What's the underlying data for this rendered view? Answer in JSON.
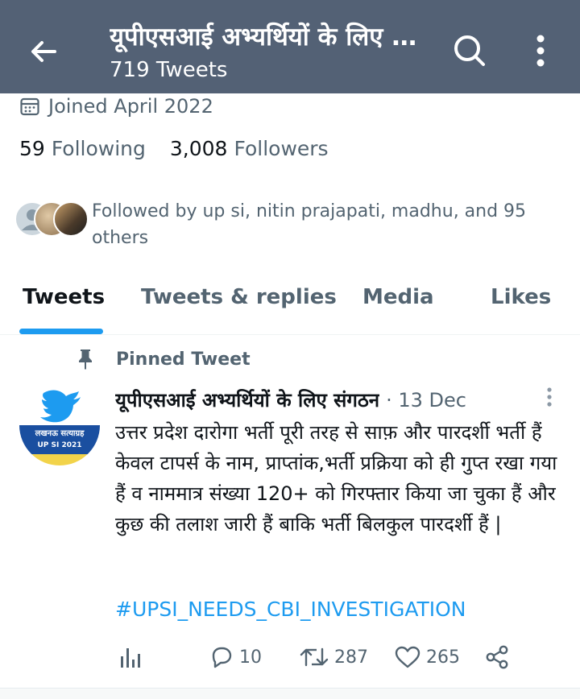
{
  "header": {
    "title": "यूपीएसआई अभ्यर्थियों के लिए संगठन",
    "tweet_count": "719 Tweets"
  },
  "profile": {
    "joined": "Joined April 2022",
    "following_count": "59",
    "following_label": "Following",
    "followers_count": "3,008",
    "followers_label": "Followers",
    "followed_by": "Followed by up si, nitin prajapati, madhu, and 95 others"
  },
  "tabs": [
    {
      "label": "Tweets",
      "active": true
    },
    {
      "label": "Tweets & replies",
      "active": false
    },
    {
      "label": "Media",
      "active": false
    },
    {
      "label": "Likes",
      "active": false
    }
  ],
  "pinned_tweet": {
    "pinned_label": "Pinned Tweet",
    "author_name": "यूपीएसआई अभ्यर्थियों के लिए संगठन",
    "date": "· 13 Dec",
    "avatar_text_1": "लखनऊ सत्याग्रह",
    "avatar_text_2": "UP SI 2021",
    "text": "उत्तर प्रदेश दारोगा भर्ती पूरी तरह से साफ़ और पारदर्शी भर्ती हैं केवल टापर्स के नाम, प्राप्तांक,भर्ती प्रक्रिया को ही गुप्त रखा गया हैं व नाममात्र संख्या 120+ को गिरफ्तार किया जा चुका हैं और कुछ की तलाश जारी हैं बाकि भर्ती बिलकुल पारदर्शी हैं |",
    "hashtag": "#UPSI_NEEDS_CBI_INVESTIGATION",
    "replies": "10",
    "retweets": "287",
    "likes": "265"
  },
  "icons": {
    "back": "arrow-left-icon",
    "search": "search-icon",
    "more": "more-vertical-icon",
    "calendar": "calendar-icon",
    "pin": "pin-icon",
    "analytics": "analytics-icon",
    "reply": "reply-icon",
    "retweet": "retweet-icon",
    "like": "heart-icon",
    "share": "share-icon"
  },
  "colors": {
    "header_bg": "#536175",
    "accent": "#1d9bf0",
    "secondary_text": "#536471"
  }
}
